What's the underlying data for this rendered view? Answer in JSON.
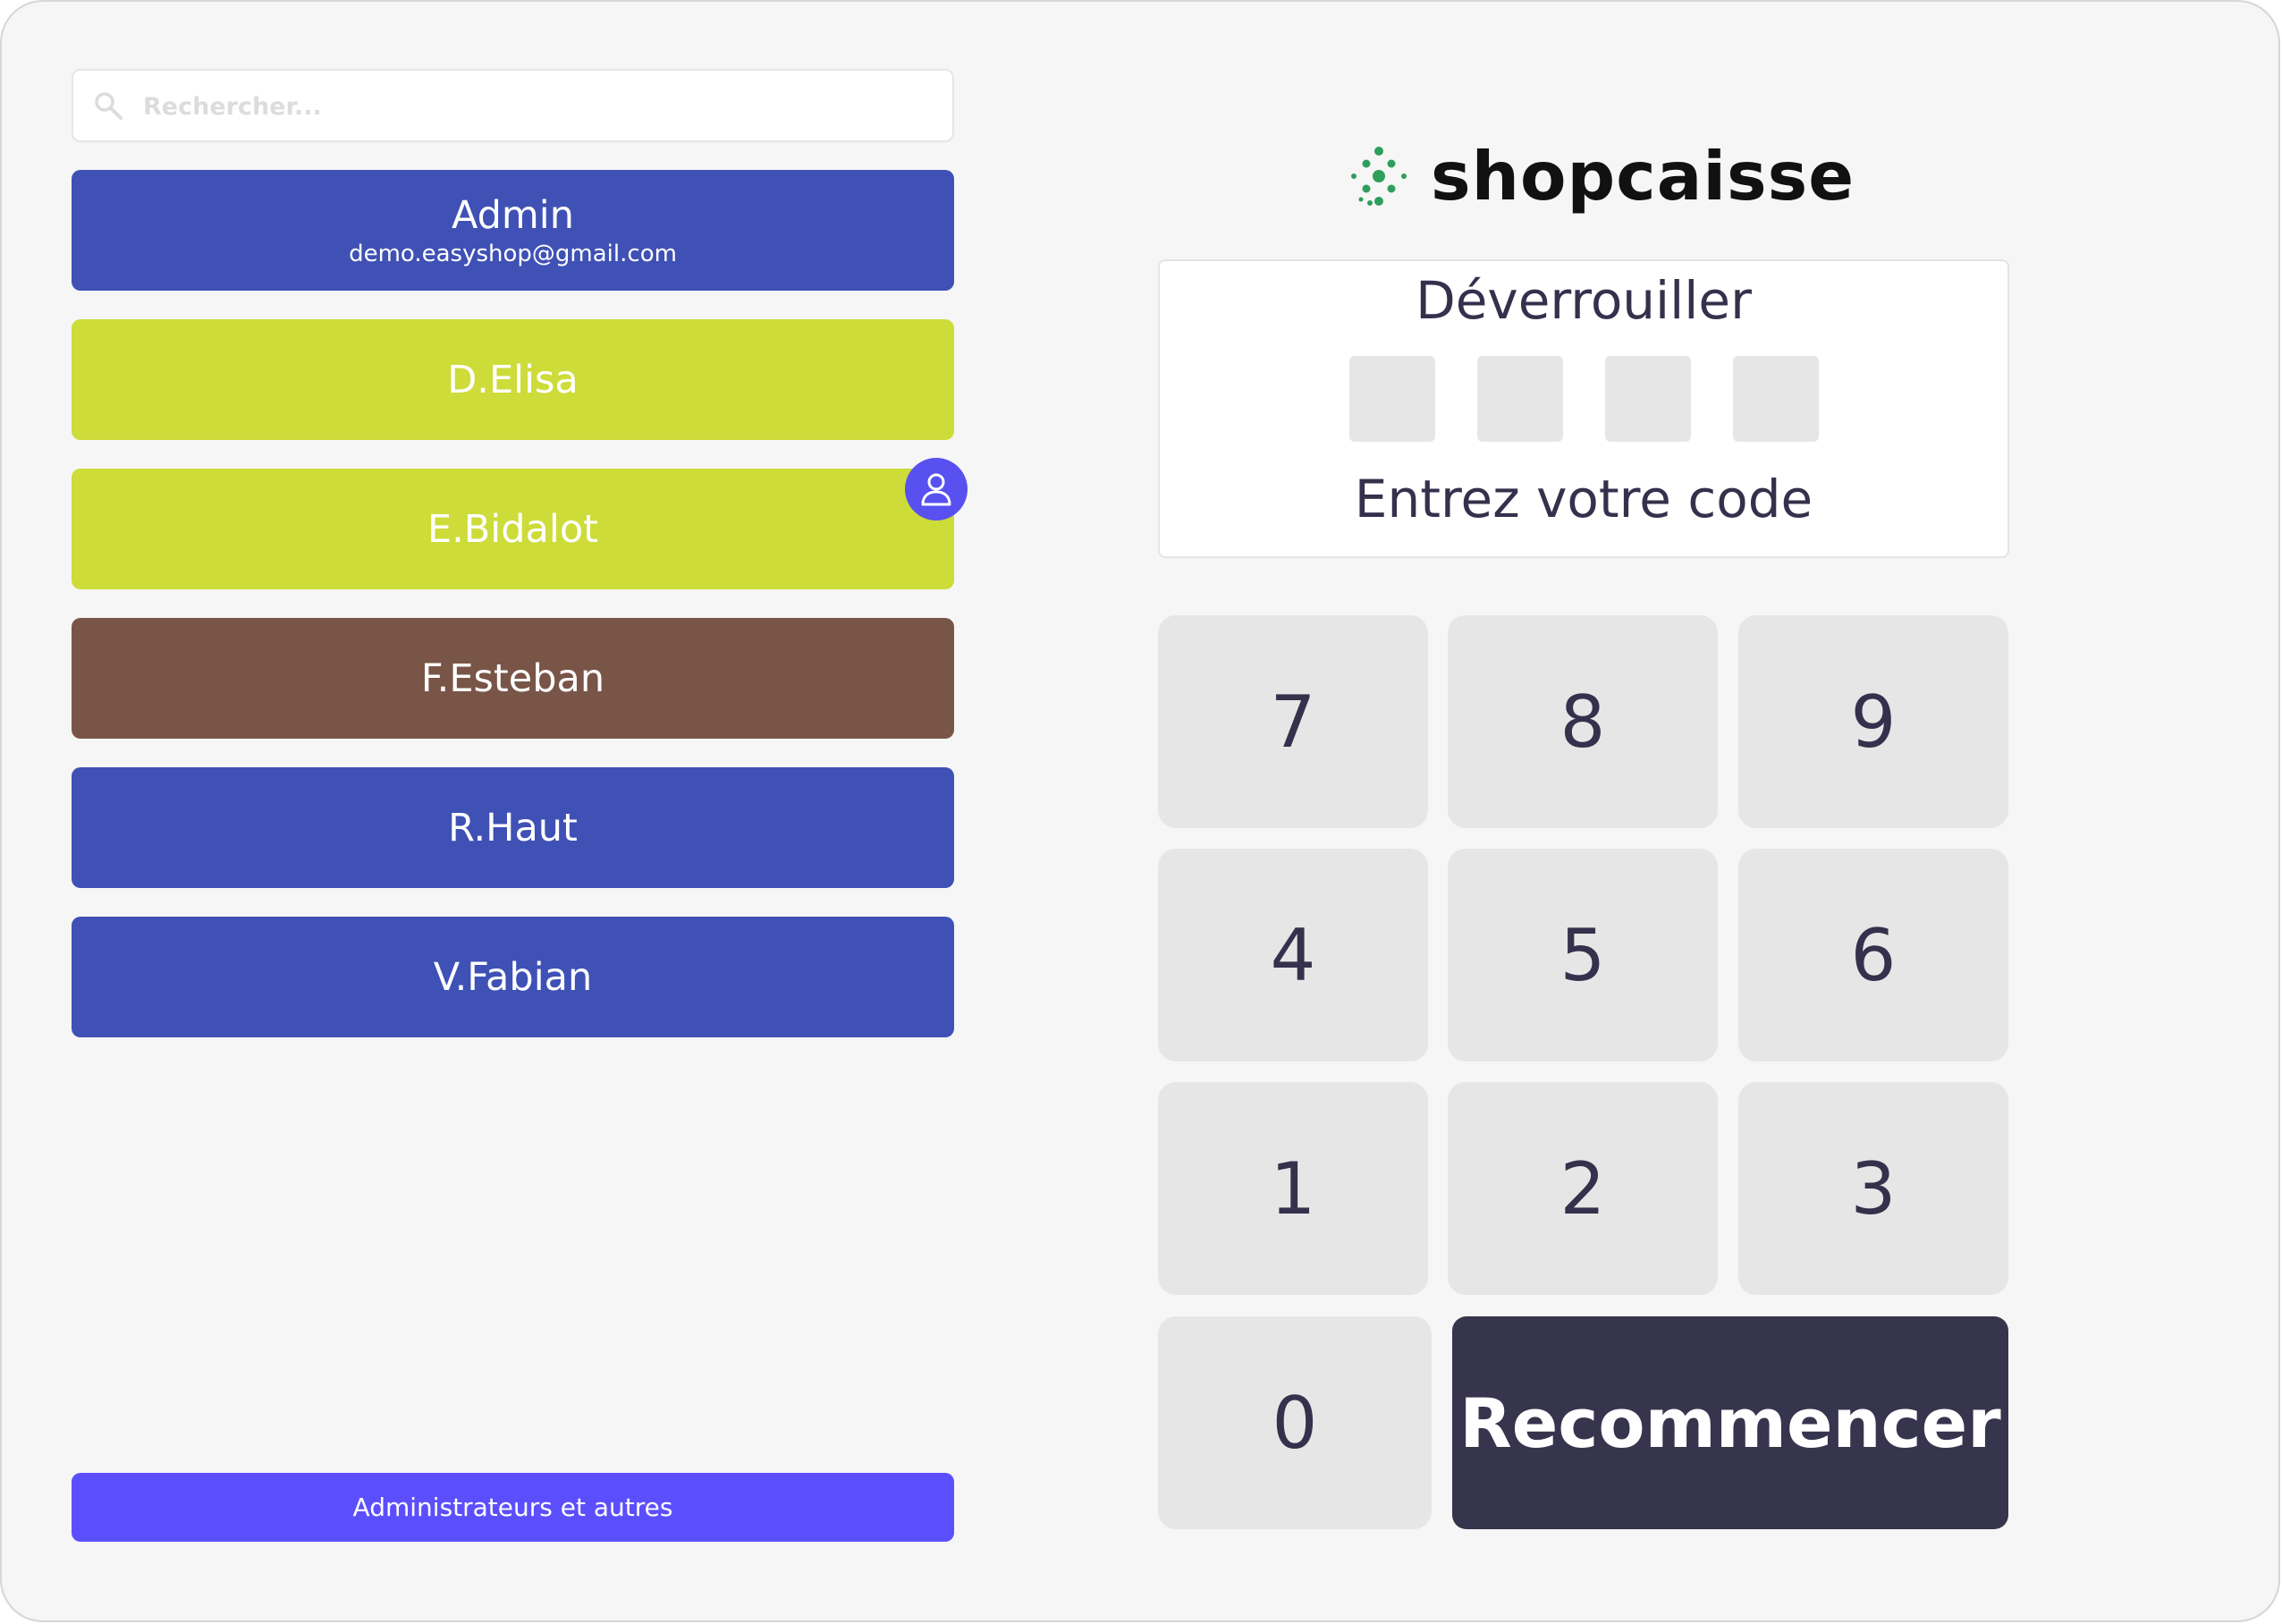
{
  "search": {
    "placeholder": "Rechercher...",
    "value": ""
  },
  "users": [
    {
      "name": "Admin",
      "email": "demo.easyshop@gmail.com",
      "color": "#3f51b5"
    },
    {
      "name": "D.Elisa",
      "color": "#cddc39"
    },
    {
      "name": "E.Bidalot",
      "color": "#cddc39"
    },
    {
      "name": "F.Esteban",
      "color": "#795548"
    },
    {
      "name": "R.Haut",
      "color": "#3f51b5"
    },
    {
      "name": "V.Fabian",
      "color": "#3f51b5"
    }
  ],
  "admin_others_label": "Administrateurs et autres",
  "brand": {
    "name": "shopcaisse",
    "accent": "#2e9e5b"
  },
  "unlock": {
    "title": "Déverrouiller",
    "hint": "Entrez votre code",
    "pin_length": 4
  },
  "keypad": {
    "keys": [
      "7",
      "8",
      "9",
      "4",
      "5",
      "6",
      "1",
      "2",
      "3",
      "0"
    ],
    "reset_label": "Recommencer"
  },
  "colors": {
    "primary_indigo": "#3f51b5",
    "lime": "#cddc39",
    "brown": "#795548",
    "violet": "#5b4ffd",
    "dark": "#37344d",
    "key_bg": "#e6e6e6"
  }
}
